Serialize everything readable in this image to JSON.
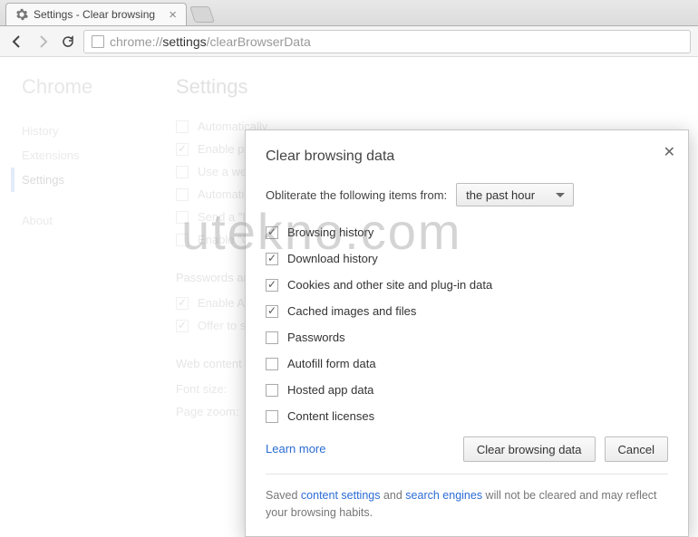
{
  "tab": {
    "title": "Settings - Clear browsing"
  },
  "omnibox": {
    "scheme": "chrome://",
    "host": "settings",
    "path": "/clearBrowserData"
  },
  "brand": "Chrome",
  "sidebar": {
    "items": [
      {
        "label": "History"
      },
      {
        "label": "Extensions"
      },
      {
        "label": "Settings",
        "active": true
      },
      {
        "label": "About"
      }
    ]
  },
  "settings_title": "Settings",
  "background_options": [
    {
      "label": "Automatically",
      "checked": false
    },
    {
      "label": "Enable phish",
      "checked": true
    },
    {
      "label": "Use a web se",
      "checked": false
    },
    {
      "label": "Automatically",
      "checked": false
    },
    {
      "label": "Send a \"Do N",
      "checked": false
    },
    {
      "label": "Enable \"Ok G",
      "checked": false
    }
  ],
  "passwords_section": {
    "title": "Passwords and fo",
    "options": [
      {
        "label": "Enable Autof",
        "checked": true
      },
      {
        "label": "Offer to save",
        "checked": true
      }
    ]
  },
  "webcontent_section": {
    "title": "Web content",
    "rows": [
      {
        "label": "Font size:"
      },
      {
        "label": "Page zoom:"
      }
    ]
  },
  "modal": {
    "title": "Clear browsing data",
    "obliterate_label": "Obliterate the following items from:",
    "timeframe_selected": "the past hour",
    "options": [
      {
        "label": "Browsing history",
        "checked": true
      },
      {
        "label": "Download history",
        "checked": true
      },
      {
        "label": "Cookies and other site and plug-in data",
        "checked": true
      },
      {
        "label": "Cached images and files",
        "checked": true
      },
      {
        "label": "Passwords",
        "checked": false
      },
      {
        "label": "Autofill form data",
        "checked": false
      },
      {
        "label": "Hosted app data",
        "checked": false
      },
      {
        "label": "Content licenses",
        "checked": false
      }
    ],
    "learn_more": "Learn more",
    "primary_button": "Clear browsing data",
    "cancel_button": "Cancel",
    "footer_prefix": "Saved ",
    "footer_link1": "content settings",
    "footer_mid": " and ",
    "footer_link2": "search engines",
    "footer_suffix": " will not be cleared and may reflect your browsing habits."
  },
  "watermark": "utekno.com"
}
